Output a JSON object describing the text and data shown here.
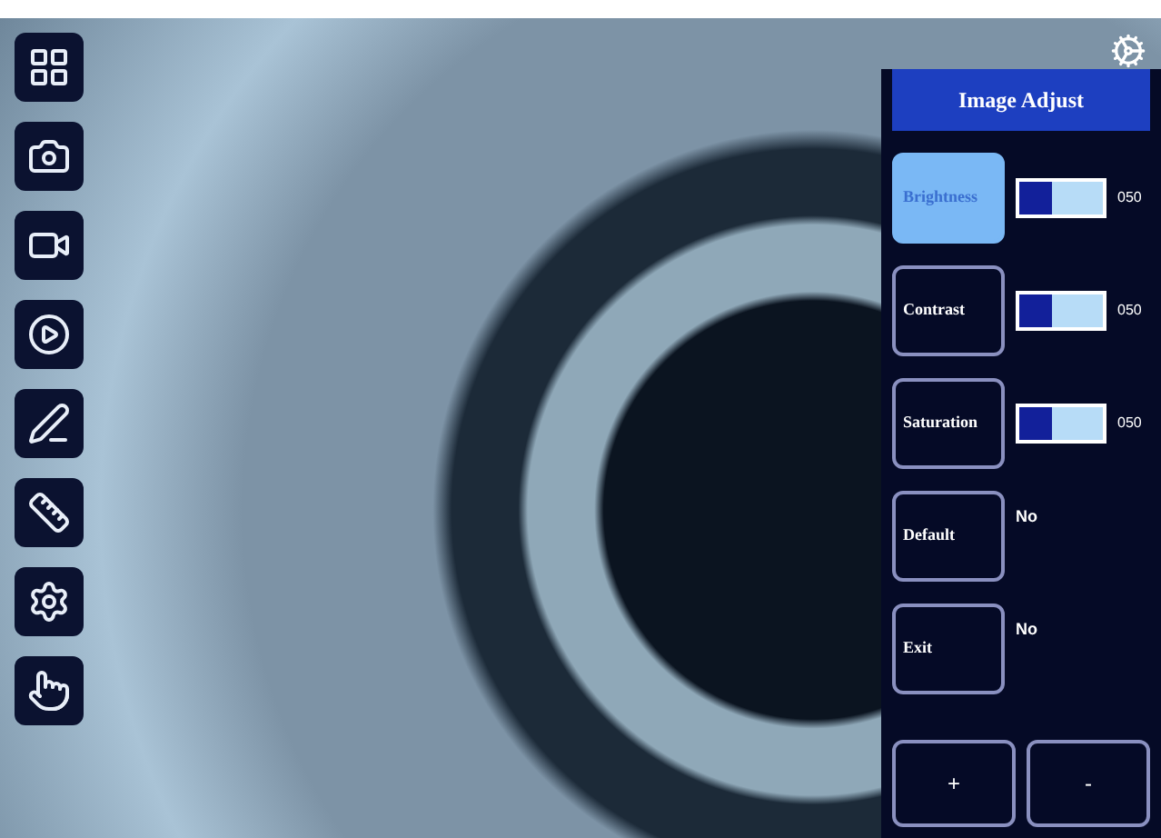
{
  "toolbar": {
    "items": [
      {
        "kind": "grid",
        "selected": false
      },
      {
        "kind": "camera",
        "selected": false
      },
      {
        "kind": "video",
        "selected": false
      },
      {
        "kind": "play",
        "selected": false
      },
      {
        "kind": "pen",
        "selected": false
      },
      {
        "kind": "ruler",
        "selected": false
      },
      {
        "kind": "settings",
        "selected": false
      },
      {
        "kind": "hand",
        "selected": false
      }
    ]
  },
  "panel": {
    "title": "Image Adjust",
    "rows": [
      {
        "kind": "slider",
        "label": "Brightness",
        "selected": true,
        "level": 0.4,
        "reading": "050"
      },
      {
        "kind": "slider",
        "label": "Contrast",
        "selected": false,
        "level": 0.4,
        "reading": "050"
      },
      {
        "kind": "slider",
        "label": "Saturation",
        "selected": false,
        "level": 0.4,
        "reading": "050"
      },
      {
        "kind": "option",
        "label": "Default",
        "selected": false,
        "value": "No"
      },
      {
        "kind": "option",
        "label": "Exit",
        "selected": false,
        "value": "No"
      }
    ],
    "buttons": [
      "+",
      "-"
    ]
  }
}
